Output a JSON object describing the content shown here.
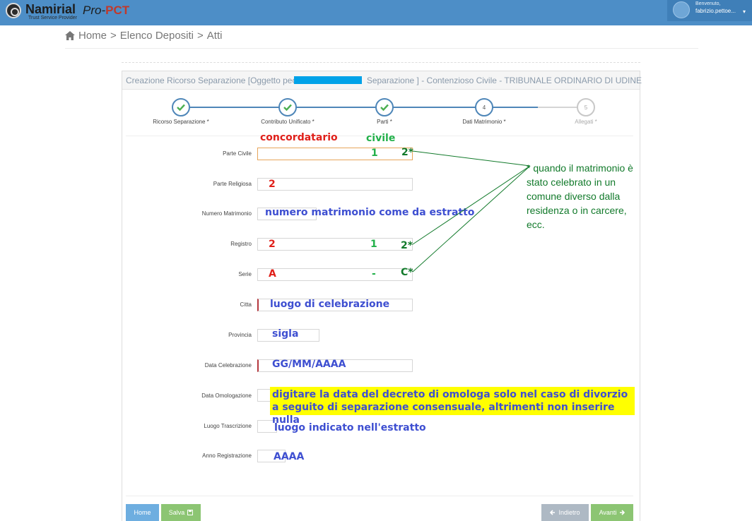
{
  "header": {
    "brand": "Namirial",
    "brand_sub": "Trust Service Provider",
    "product": "Pro-",
    "product_accent": "PCT",
    "welcome": "Benvenuto,",
    "username": "fabrizio.pettoe...",
    "caret": "▾"
  },
  "breadcrumb": {
    "items": [
      "Home",
      "Elenco Depositi",
      "Atti"
    ],
    "separator": ">"
  },
  "panel": {
    "title_before": "Creazione Ricorso Separazione [Oggetto pec:",
    "title_after": "Separazione ] - Contenzioso Civile - TRIBUNALE ORDINARIO DI UDINE"
  },
  "steps": [
    {
      "label": "Ricorso Separazione *",
      "num": "1",
      "status": "done"
    },
    {
      "label": "Contributo Unificato *",
      "num": "2",
      "status": "done"
    },
    {
      "label": "Parti *",
      "num": "3",
      "status": "done"
    },
    {
      "label": "Dati Matrimonio *",
      "num": "4",
      "status": "current"
    },
    {
      "label": "Allegati *",
      "num": "5",
      "status": "pending"
    }
  ],
  "form": {
    "fields": [
      {
        "label": "Parte Civile"
      },
      {
        "label": "Parte Religiosa"
      },
      {
        "label": "Numero Matrimonio"
      },
      {
        "label": "Registro"
      },
      {
        "label": "Serie"
      },
      {
        "label": "Citta"
      },
      {
        "label": "Provincia"
      },
      {
        "label": "Data Celebrazione"
      },
      {
        "label": "Data Omologazione"
      },
      {
        "label": "Luogo Trascrizione"
      },
      {
        "label": "Anno Registrazione"
      }
    ]
  },
  "annotations": {
    "concordatario": "concordatario",
    "civile": "civile",
    "pc_1": "1",
    "pc_2": "2*",
    "pr_2": "2",
    "numero": "numero matrimonio come da estratto",
    "reg_2": "2",
    "reg_1": "1",
    "reg_2star": "2*",
    "serie_a": "A",
    "serie_dash": "-",
    "serie_c": "C*",
    "citta": "luogo di celebrazione",
    "provincia": "sigla",
    "data_cel": "GG/MM/AAAA",
    "data_omol": "digitare la data del decreto di omologa solo nel caso di divorzio a seguito di separazione consensuale, altrimenti non inserire nulla",
    "luogo_tras": "luogo indicato nell'estratto",
    "anno": "AAAA",
    "side_note": "* quando il matrimonio è stato celebrato in un comune diverso dalla residenza o in carcere, ecc."
  },
  "footer": {
    "home": "Home",
    "salva": "Salva",
    "indietro": "Indietro",
    "avanti": "Avanti"
  },
  "colors": {
    "topbar": "#4d8ec7",
    "step_done": "#4caf50",
    "step_line": "#4e86b8",
    "annotation_red": "#e0201a",
    "annotation_green": "#22b04a",
    "annotation_blue": "#3e4fd1",
    "highlight_yellow": "#ffff00"
  }
}
